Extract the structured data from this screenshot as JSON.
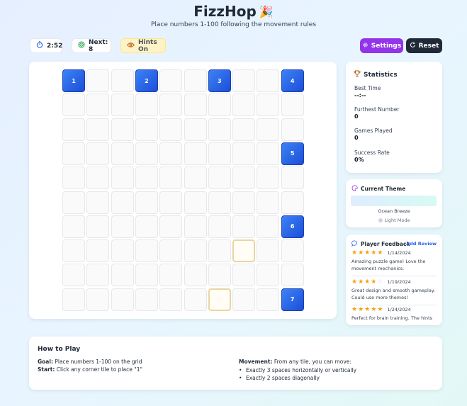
{
  "header": {
    "title": "FizzHop",
    "title_emoji": "🎉",
    "subtitle": "Place numbers 1-100 following the movement rules"
  },
  "toolbar": {
    "timer": "2:52",
    "next_label": "Next: 8",
    "hints_label": "Hints On",
    "settings_label": "Settings",
    "reset_label": "Reset"
  },
  "board": {
    "size": 10,
    "cells": [
      {
        "row": 0,
        "col": 0,
        "value": "1"
      },
      {
        "row": 0,
        "col": 3,
        "value": "2"
      },
      {
        "row": 0,
        "col": 6,
        "value": "3"
      },
      {
        "row": 0,
        "col": 9,
        "value": "4"
      },
      {
        "row": 3,
        "col": 9,
        "value": "5"
      },
      {
        "row": 6,
        "col": 9,
        "value": "6"
      },
      {
        "row": 9,
        "col": 9,
        "value": "7"
      }
    ],
    "hint_cells": [
      {
        "row": 7,
        "col": 7
      },
      {
        "row": 9,
        "col": 6
      }
    ]
  },
  "statistics": {
    "title": "Statistics",
    "best_time_label": "Best Time",
    "best_time": "--:--",
    "furthest_label": "Furthest Number",
    "furthest": "0",
    "games_played_label": "Games Played",
    "games_played": "0",
    "success_rate_label": "Success Rate",
    "success_rate": "0%"
  },
  "theme": {
    "title": "Current Theme",
    "name": "Ocean Breeze",
    "mode": "Light Mode"
  },
  "feedback": {
    "title": "Player Feedback",
    "add_review_label": "Add Review",
    "reviews": [
      {
        "rating": 5,
        "date": "1/14/2024",
        "text": "Amazing puzzle game! Love the movement mechanics."
      },
      {
        "rating": 4,
        "date": "1/19/2024",
        "text": "Great design and smooth gameplay. Could use more themes!"
      },
      {
        "rating": 5,
        "date": "1/24/2024",
        "text": "Perfect for brain training. The hints"
      }
    ]
  },
  "how_to_play": {
    "title": "How to Play",
    "goal_label": "Goal:",
    "goal_text": "Place numbers 1-100 on the grid",
    "start_label": "Start:",
    "start_text": "Click any corner tile to place \"1\"",
    "movement_label": "Movement:",
    "movement_text": "From any tile, you can move:",
    "rules": [
      "Exactly 3 spaces horizontally or vertically",
      "Exactly 2 spaces diagonally"
    ]
  },
  "colors": {
    "accent_purple": "#9333ea",
    "tile_blue": "#2563eb",
    "dark": "#1f2937",
    "hint_yellow": "#fef3c7"
  }
}
